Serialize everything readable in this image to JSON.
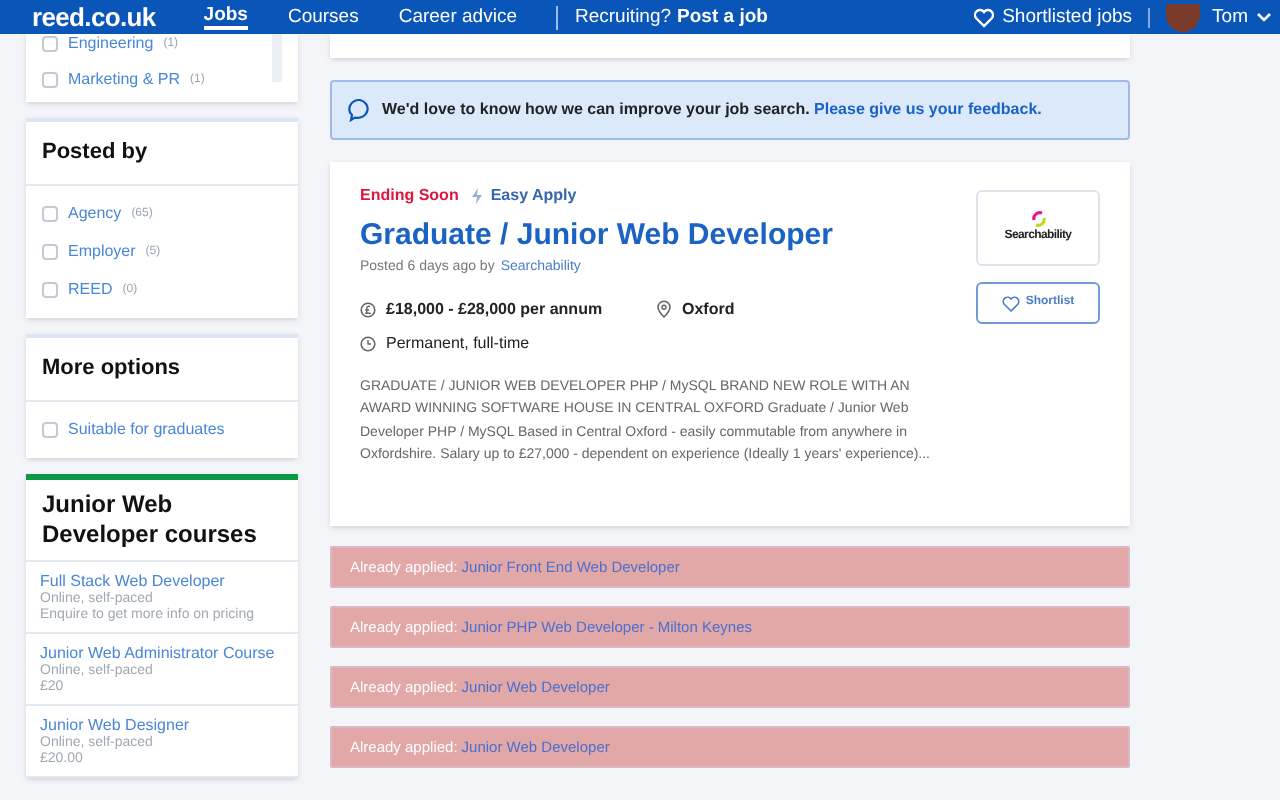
{
  "nav": {
    "logo": "reed.co.uk",
    "links": [
      {
        "label": "Jobs",
        "selected": true
      },
      {
        "label": "Courses",
        "selected": false
      },
      {
        "label": "Career advice",
        "selected": false
      }
    ],
    "recruiting": "Recruiting?",
    "post_job": "Post a job",
    "shortlisted": "Shortlisted jobs",
    "user": "Tom"
  },
  "sidebar": {
    "top_filters": [
      {
        "label": "Engineering",
        "count": "(1)",
        "checked": false
      },
      {
        "label": "Marketing & PR",
        "count": "(1)",
        "checked": false
      }
    ],
    "posted_by": {
      "title": "Posted by",
      "options": [
        {
          "label": "Agency",
          "count": "(65)",
          "checked": false
        },
        {
          "label": "Employer",
          "count": "(5)",
          "checked": false
        },
        {
          "label": "REED",
          "count": "(0)",
          "checked": false
        }
      ]
    },
    "more_options": {
      "title": "More options",
      "options": [
        {
          "label": "Suitable for graduates",
          "checked": false
        }
      ]
    },
    "courses": {
      "title": "Junior Web Developer courses",
      "items": [
        {
          "title": "Full Stack Web Developer",
          "mode": "Online, self-paced",
          "price": "Enquire to get more info on pricing"
        },
        {
          "title": "Junior Web Administrator Course",
          "mode": "Online, self-paced",
          "price": "£20"
        },
        {
          "title": "Junior Web Designer",
          "mode": "Online, self-paced",
          "price": "£20.00"
        }
      ]
    }
  },
  "feedback": {
    "text": "We'd love to know how we can improve your job search.",
    "link": "Please give us your feedback."
  },
  "job": {
    "badge": "Ending Soon",
    "easy_apply": "Easy Apply",
    "title": "Graduate / Junior Web Developer",
    "posted": "Posted 6 days ago by",
    "company": "Searchability",
    "salary": "£18,000 - £28,000 per annum",
    "location": "Oxford",
    "type": "Permanent, full-time",
    "description": "GRADUATE / JUNIOR WEB DEVELOPER PHP / MySQL BRAND NEW ROLE WITH AN AWARD WINNING SOFTWARE HOUSE IN CENTRAL OXFORD Graduate / Junior Web Developer PHP / MySQL Based in Central Oxford - easily commutable from anywhere in Oxfordshire. Salary up to £27,000 - dependent on experience (Ideally 1 years' experience)...",
    "logo_text": "Searchability",
    "shortlist": "Shortlist"
  },
  "applied": [
    {
      "prefix": "Already applied:",
      "title": "Junior Front End Web Developer"
    },
    {
      "prefix": "Already applied:",
      "title": "Junior PHP Web Developer - Milton Keynes"
    },
    {
      "prefix": "Already applied:",
      "title": "Junior Web Developer"
    },
    {
      "prefix": "Already applied:",
      "title": "Junior Web Developer"
    }
  ]
}
